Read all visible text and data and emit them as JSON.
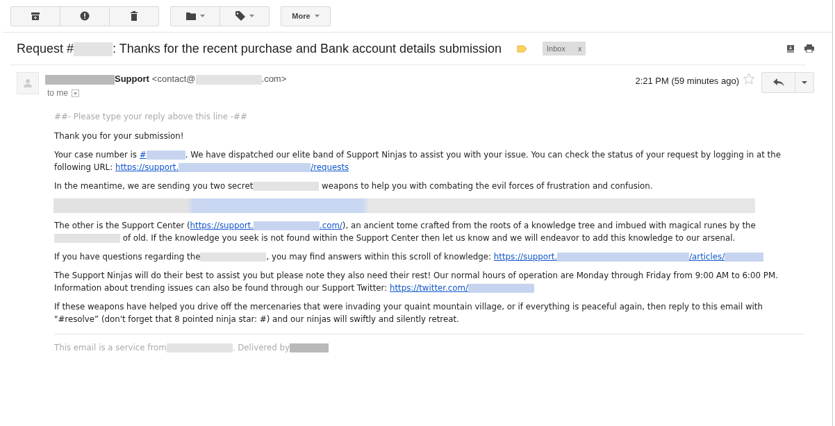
{
  "toolbar": {
    "groups": [
      [
        {
          "kind": "archive"
        },
        {
          "kind": "spam"
        },
        {
          "kind": "delete"
        }
      ],
      [
        {
          "kind": "folder",
          "menu": true
        },
        {
          "kind": "label",
          "menu": true
        }
      ],
      [
        {
          "kind": "text",
          "label": "More",
          "menu": true
        }
      ]
    ]
  },
  "subject": [
    {
      "kind": "text",
      "text": "Request #"
    },
    {
      "kind": "blur"
    },
    {
      "kind": "text",
      "text": ": Thanks for the recent purchase and Bank account details submission"
    }
  ],
  "label_chip": {
    "text": "Inbox",
    "remove": "x"
  },
  "sender": {
    "name": [
      {
        "kind": "darkblurwide"
      },
      {
        "kind": "text",
        "text": "Support"
      }
    ],
    "address": [
      {
        "kind": "text",
        "text": "<contact@"
      },
      {
        "kind": "blurwide"
      },
      {
        "kind": "text",
        "text": ".com>"
      }
    ],
    "to": "to me",
    "time": "2:21 PM (59 minutes ago)",
    "starred": false
  },
  "body": {
    "reply_line": "##- Please type your reply above this line -##",
    "paragraphs": [
      [
        {
          "kind": "text",
          "text": "Thank you for your submission!"
        }
      ],
      [
        {
          "kind": "text",
          "text": "Your case number is "
        },
        {
          "kind": "link",
          "text": "#"
        },
        {
          "kind": "linkblur"
        },
        {
          "kind": "text",
          "text": ". We have dispatched our elite band of Support Ninjas to assist you with your issue. You can check the status of your request by logging in at the following URL: "
        },
        {
          "kind": "link",
          "text": "https://support."
        },
        {
          "kind": "linkblurlong"
        },
        {
          "kind": "link",
          "text": "/requests"
        }
      ],
      [
        {
          "kind": "text",
          "text": "In the meantime, we are sending you two secret"
        },
        {
          "kind": "blurwide"
        },
        {
          "kind": "text",
          "text": " weapons to help you with combating the evil forces of frustration and confusion."
        }
      ],
      [
        {
          "kind": "blurline"
        }
      ],
      [
        {
          "kind": "text",
          "text": "The other is the Support Center ("
        },
        {
          "kind": "link",
          "text": "https://support."
        },
        {
          "kind": "linkblurwide"
        },
        {
          "kind": "link",
          "text": ".com/"
        },
        {
          "kind": "text",
          "text": "), an ancient tome crafted from the roots of a knowledge tree and imbued with magical runes by the "
        },
        {
          "kind": "blurwide"
        },
        {
          "kind": "text",
          "text": " of old. If the knowledge you seek is not found within the Support Center then let us know and we will endeavor to add this knowledge to our arsenal."
        }
      ],
      [
        {
          "kind": "text",
          "text": "If you have questions regarding the"
        },
        {
          "kind": "blurwide"
        },
        {
          "kind": "text",
          "text": ", you may find answers within this scroll of knowledge: "
        },
        {
          "kind": "link",
          "text": "https://support."
        },
        {
          "kind": "linkblurlong"
        },
        {
          "kind": "link",
          "text": "/articles/"
        },
        {
          "kind": "linkblur"
        }
      ],
      [
        {
          "kind": "text",
          "text": "The Support Ninjas will do their best to assist you but please note they also need their rest! Our normal hours of operation are Monday through Friday from 9:00 AM to 6:00 PM. Information about trending issues can also be found through our Support Twitter: "
        },
        {
          "kind": "link",
          "text": "https://twitter.com/"
        },
        {
          "kind": "linkblurwide"
        }
      ],
      [
        {
          "kind": "text",
          "text": "If these weapons have helped you drive off the mercenaries that were invading your quaint mountain village, or if everything is peaceful again, then reply to this email with \"#resolve” (don't forget that 8 pointed ninja star: #) and our ninjas will swiftly and silently retreat."
        }
      ]
    ],
    "footer": [
      {
        "kind": "text",
        "text": "This email is a service from"
      },
      {
        "kind": "blurwide"
      },
      {
        "kind": "text",
        "text": ". Delivered by"
      },
      {
        "kind": "darkblur"
      }
    ]
  }
}
